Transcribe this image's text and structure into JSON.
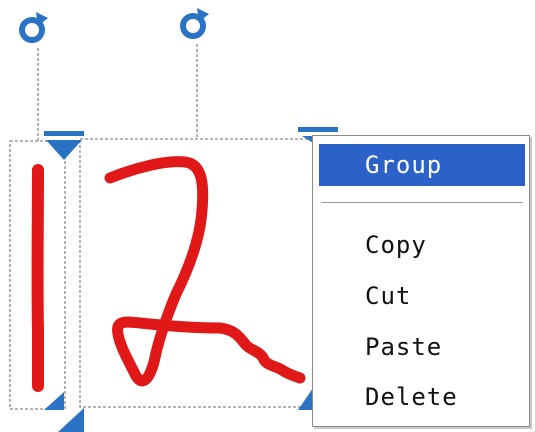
{
  "context_menu": {
    "items": [
      {
        "label": "Group",
        "selected": true
      },
      {
        "label": "Copy",
        "selected": false
      },
      {
        "label": "Cut",
        "selected": false
      },
      {
        "label": "Paste",
        "selected": false
      },
      {
        "label": "Delete",
        "selected": false
      }
    ]
  },
  "ink_strokes": [
    {
      "name": "digit-1-stroke",
      "color": "#e11818"
    },
    {
      "name": "digit-2-stroke",
      "color": "#e11818"
    }
  ],
  "colors": {
    "ink": "#e11818",
    "handle": "#2a73c4",
    "selection_border": "#8a8a8a",
    "menu_highlight": "#2c62c8"
  }
}
